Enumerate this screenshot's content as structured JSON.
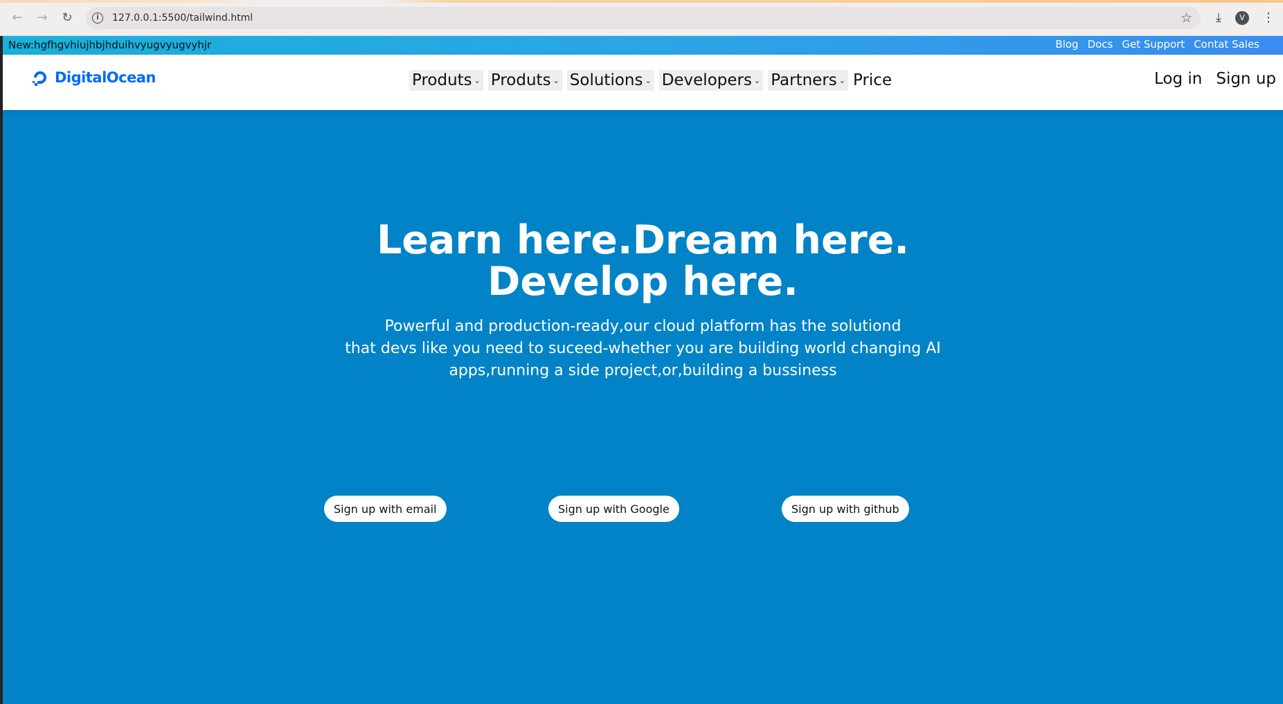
{
  "browser": {
    "url": "127.0.0.1:5500/tailwind.html",
    "avatar_letter": "V",
    "icons": {
      "back": "←",
      "forward": "→",
      "reload": "↻",
      "info": "i",
      "star": "☆",
      "download": "⤓",
      "menu": "⋮"
    }
  },
  "promo": {
    "text": "New:hgfhgvhiujhbjhduihvyugvyugvyhjr",
    "links": [
      "Blog",
      "Docs",
      "Get Support",
      "Contat Sales"
    ]
  },
  "navbar": {
    "logo_text": "DigitalOcean",
    "menu": [
      {
        "label": "Produts",
        "dropdown": true
      },
      {
        "label": "Produts",
        "dropdown": true
      },
      {
        "label": "Solutions",
        "dropdown": true
      },
      {
        "label": "Developers",
        "dropdown": true
      },
      {
        "label": "Partners",
        "dropdown": true
      },
      {
        "label": "Price",
        "dropdown": false
      }
    ],
    "chevron": "⌄",
    "login": "Log in",
    "signup": "Sign up"
  },
  "hero": {
    "title_line1": "Learn here.Dream here.",
    "title_line2": "Develop here.",
    "subtitle_line1": "Powerful and production-ready,our cloud platform has the solutiond",
    "subtitle_line2": "that devs like you need to suceed-whether you are building world changing AI",
    "subtitle_line3": "apps,running a side project,or,building a bussiness"
  },
  "cta": {
    "email": "Sign up with email",
    "google": "Sign up with Google",
    "github": "Sign up with github"
  },
  "colors": {
    "page_bg": "#0283c7",
    "promo_start": "#1ab0d9",
    "promo_end": "#3a8cf0",
    "brand": "#0069ff"
  }
}
